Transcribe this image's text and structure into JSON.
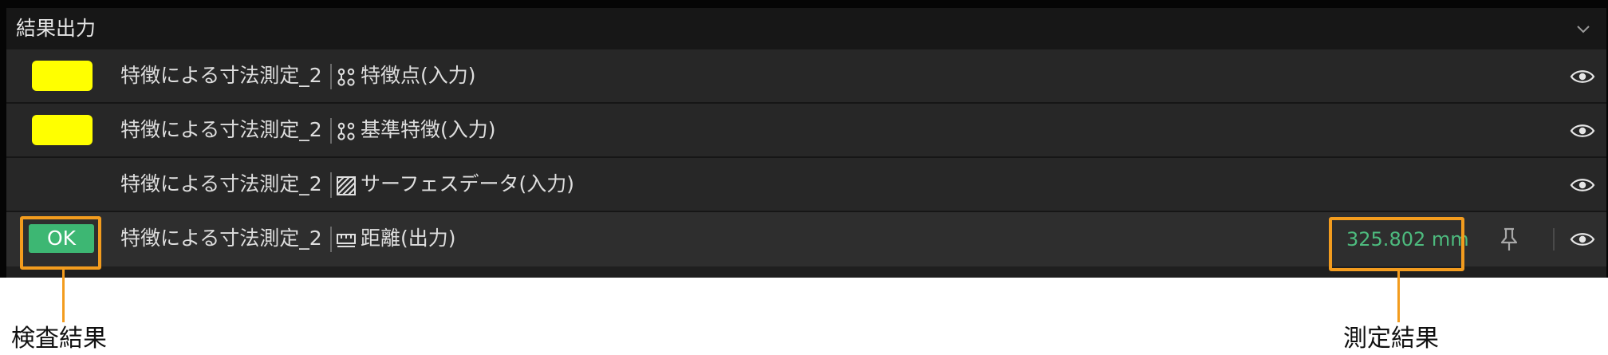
{
  "panel": {
    "title": "結果出力",
    "collapse_icon": "chevron-down-icon"
  },
  "rows": [
    {
      "indicator": "yellow-swatch",
      "indicator_color": "#ffff00",
      "source": "特徴による寸法測定_2",
      "icon": "feature-points-icon",
      "label": "特徴点(入力)",
      "visibility_icon": "eye-icon"
    },
    {
      "indicator": "yellow-swatch",
      "indicator_color": "#ffff00",
      "source": "特徴による寸法測定_2",
      "icon": "feature-points-icon",
      "label": "基準特徴(入力)",
      "visibility_icon": "eye-icon"
    },
    {
      "indicator": "none",
      "source": "特徴による寸法測定_2",
      "icon": "surface-data-icon",
      "label": "サーフェスデータ(入力)",
      "visibility_icon": "eye-icon"
    },
    {
      "indicator": "ok-badge",
      "badge_text": "OK",
      "badge_color": "#3db773",
      "source": "特徴による寸法測定_2",
      "icon": "distance-ruler-icon",
      "label": "距離(出力)",
      "measurement": "325.802 mm",
      "measurement_color": "#4dbb7e",
      "pin_icon": "pin-icon",
      "visibility_icon": "eye-icon"
    }
  ],
  "callouts": {
    "inspection_result": "検査結果",
    "measurement_result": "測定結果",
    "color": "#f39c1e"
  }
}
